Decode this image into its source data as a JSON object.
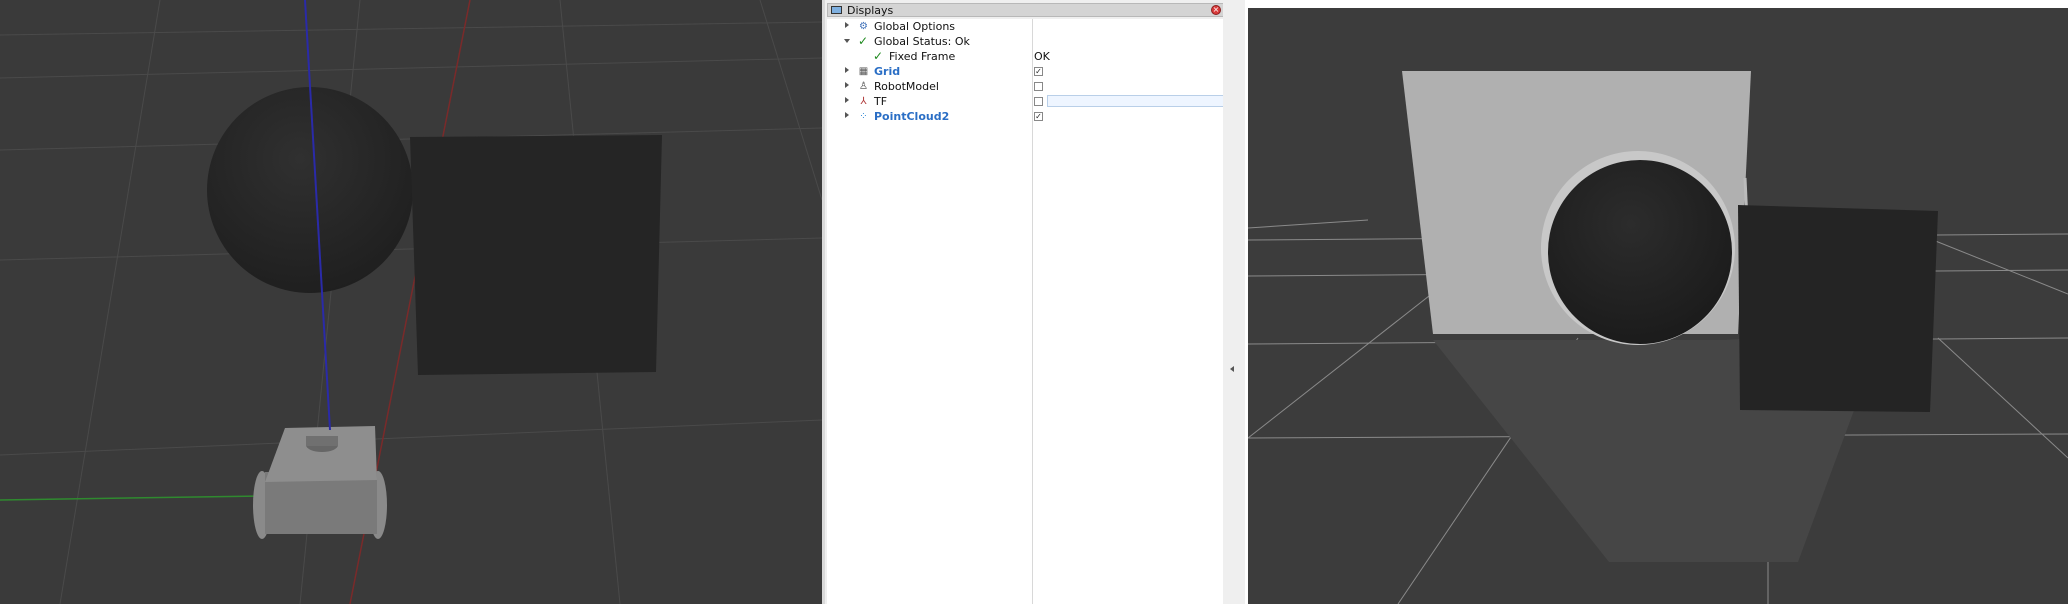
{
  "displays_panel": {
    "title": "Displays",
    "rows": [
      {
        "label": "Global Options",
        "icon": "gear-icon",
        "expand": "collapsed"
      },
      {
        "label": "Global Status: Ok",
        "icon": "check-icon",
        "expand": "expanded"
      },
      {
        "label": "Fixed Frame",
        "icon": "check-icon",
        "value": "OK"
      },
      {
        "label": "Grid",
        "icon": "grid-icon",
        "expand": "collapsed",
        "checked": true,
        "highlight": true
      },
      {
        "label": "RobotModel",
        "icon": "robot-icon",
        "expand": "collapsed",
        "checked": false
      },
      {
        "label": "TF",
        "icon": "tf-axes-icon",
        "expand": "collapsed",
        "checked": false
      },
      {
        "label": "PointCloud2",
        "icon": "pointcloud-icon",
        "expand": "collapsed",
        "checked": true,
        "highlight": true
      }
    ]
  },
  "colors": {
    "viewport_background": "#3a3a3a",
    "highlight_text": "#2a6ec5",
    "ok_check": "#1f8a1f"
  }
}
